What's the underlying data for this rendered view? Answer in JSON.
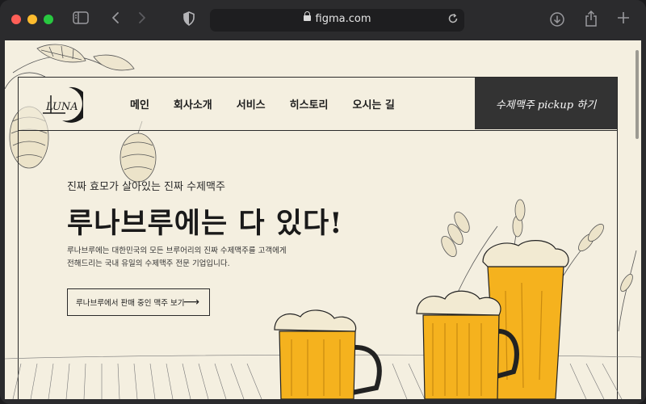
{
  "browser": {
    "url": "figma.com",
    "icons": [
      "sidebar-icon",
      "back-icon",
      "forward-icon",
      "shield-icon",
      "lock-icon",
      "reload-icon",
      "download-icon",
      "share-icon",
      "new-tab-icon"
    ]
  },
  "site": {
    "logo_text": "LUNA",
    "nav": [
      "메인",
      "회사소개",
      "서비스",
      "히스토리",
      "오시는 길"
    ],
    "cta_label": "수제맥주 pickup 하기",
    "hero": {
      "subtitle": "진짜 효모가 살아있는 진짜 수제맥주",
      "title": "루나브루에는 다 있다!",
      "desc_line1": "루나브루에는 대한민국의 모든 브루어리의 진짜 수제맥주를 고객에게",
      "desc_line2": "전해드리는 국내 유일의 수제맥주 전문 기업입니다.",
      "button_label": "루나브루에서 판매 중인 맥주 보기",
      "button_arrow": "⟶"
    }
  },
  "colors": {
    "page_bg": "#f4efe0",
    "dark": "#333333",
    "beer": "#f5b21e",
    "foam": "#f2ead2"
  }
}
